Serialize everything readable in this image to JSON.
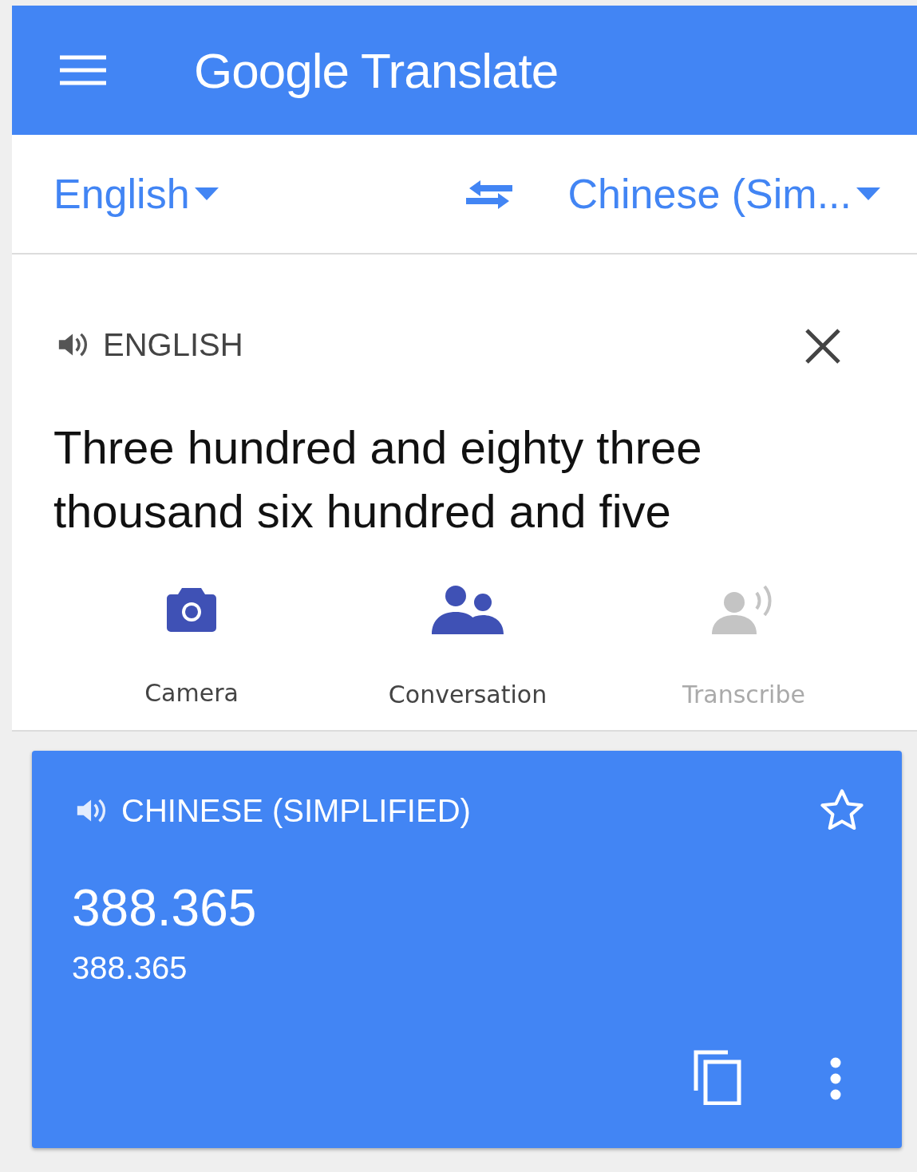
{
  "app_bar": {
    "title": "Google Translate"
  },
  "languages": {
    "source": "English",
    "target": "Chinese (Sim..."
  },
  "input": {
    "language_label": "ENGLISH",
    "text": "Three hundred and eighty three thousand six hundred and five"
  },
  "actions": [
    {
      "kind": "camera",
      "label": "Camera",
      "disabled": false
    },
    {
      "kind": "conversation",
      "label": "Conversation",
      "disabled": false
    },
    {
      "kind": "transcribe",
      "label": "Transcribe",
      "disabled": true
    }
  ],
  "result": {
    "language_label": "CHINESE (SIMPLIFIED)",
    "starred": false,
    "translation": "388.365",
    "transliteration": "388.365"
  }
}
